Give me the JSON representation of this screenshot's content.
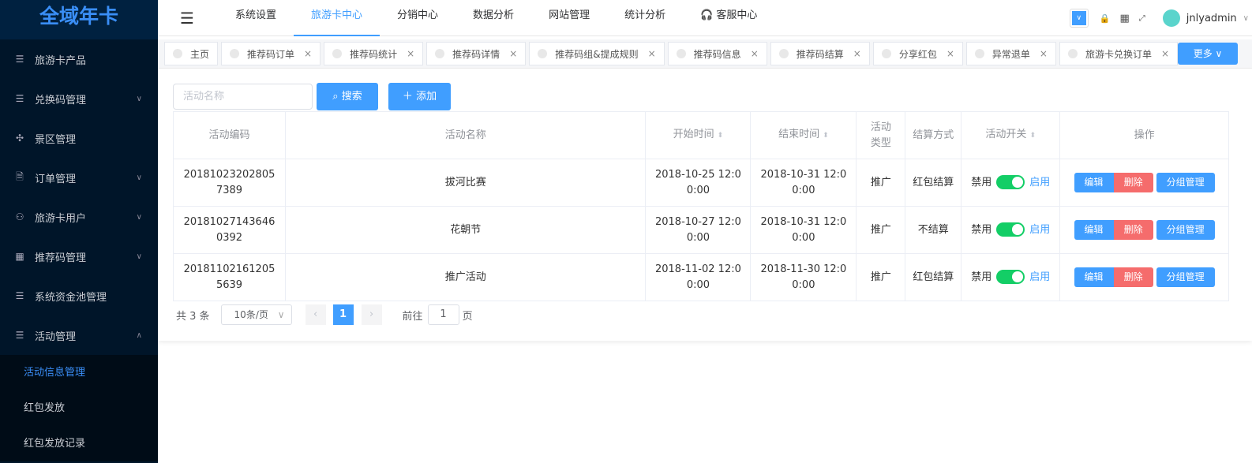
{
  "logo": "全域年卡",
  "sidebar": [
    {
      "label": "旅游卡产品",
      "icon": "list-icon"
    },
    {
      "label": "兑换码管理",
      "icon": "list-icon",
      "chevron": "down"
    },
    {
      "label": "景区管理",
      "icon": "move-icon"
    },
    {
      "label": "订单管理",
      "icon": "document-icon",
      "chevron": "down"
    },
    {
      "label": "旅游卡用户",
      "icon": "user-icon",
      "chevron": "down"
    },
    {
      "label": "推荐码管理",
      "icon": "grid-icon",
      "chevron": "down"
    },
    {
      "label": "系统资金池管理",
      "icon": "list-icon"
    },
    {
      "label": "活动管理",
      "icon": "list-icon",
      "chevron": "up"
    }
  ],
  "submenu": [
    "活动信息管理",
    "红包发放",
    "红包发放记录"
  ],
  "topnav": [
    "系统设置",
    "旅游卡中心",
    "分销中心",
    "数据分析",
    "网站管理",
    "统计分析",
    "客服中心"
  ],
  "user": "jnlyadmin",
  "tabs": [
    "主页",
    "推荐码订单",
    "推荐码统计",
    "推荐码详情",
    "推荐码组&提成规则",
    "推荐码信息",
    "推荐码结算",
    "分享红包",
    "异常退单",
    "旅游卡兑换订单"
  ],
  "more": "更多",
  "search_placeholder": "活动名称",
  "search_btn": "搜索",
  "add_btn": "添加",
  "columns": [
    "活动编码",
    "活动名称",
    "开始时间",
    "结束时间",
    "活动类型",
    "结算方式",
    "活动开关",
    "操作"
  ],
  "rows": [
    {
      "code": "201810232028057389",
      "name": "拔河比赛",
      "start": "2018-10-25 12:00:00",
      "end": "2018-10-31 12:00:00",
      "type": "推广",
      "settle": "红包结算"
    },
    {
      "code": "201810271436460392",
      "name": "花朝节",
      "start": "2018-10-27 12:00:00",
      "end": "2018-10-31 12:00:00",
      "type": "推广",
      "settle": "不结算"
    },
    {
      "code": "201811021612055639",
      "name": "推广活动",
      "start": "2018-11-02 12:00:00",
      "end": "2018-11-30 12:00:00",
      "type": "推广",
      "settle": "红包结算"
    }
  ],
  "switch": {
    "off": "禁用",
    "on": "启用"
  },
  "ops": {
    "edit": "编辑",
    "delete": "删除",
    "group": "分组管理"
  },
  "pagination": {
    "total": "共 3 条",
    "size": "10条/页",
    "page": "1",
    "goto": "前往",
    "goto_val": "1",
    "unit": "页"
  }
}
